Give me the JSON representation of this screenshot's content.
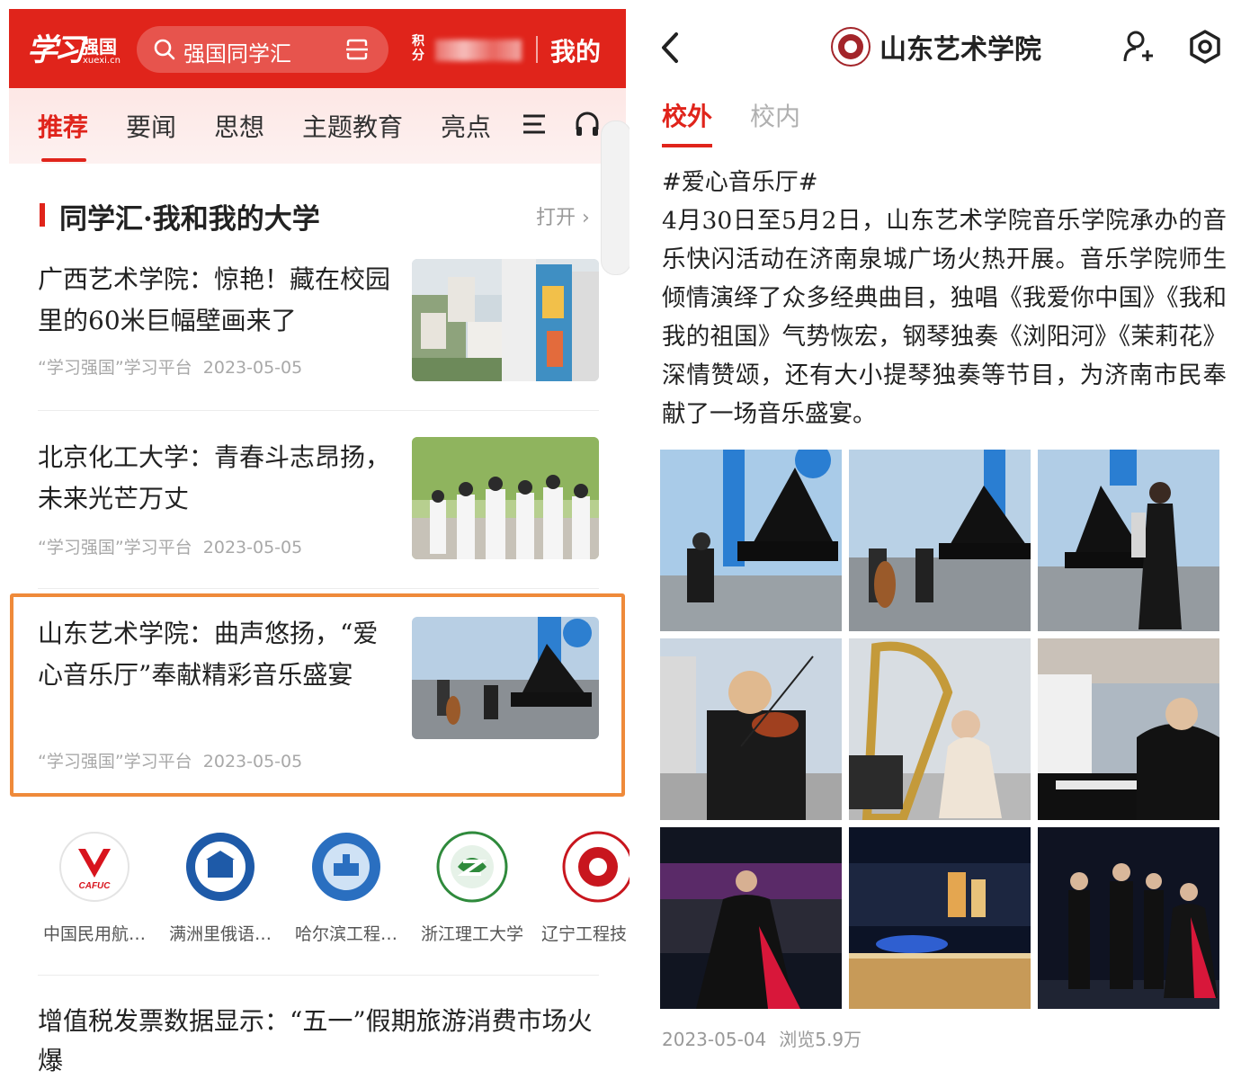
{
  "left": {
    "header": {
      "logo_calligraphy": "学习",
      "logo_name": "强国",
      "logo_url": "xuexi.cn",
      "search_placeholder": "强国同学汇",
      "points_label": "积分",
      "mine_label": "我的"
    },
    "tabs": [
      {
        "label": "推荐",
        "active": true
      },
      {
        "label": "要闻",
        "active": false
      },
      {
        "label": "思想",
        "active": false
      },
      {
        "label": "主题教育",
        "active": false
      },
      {
        "label": "亮点",
        "active": false
      }
    ],
    "section": {
      "title": "同学汇·我和我的大学",
      "open_label": "打开 ›"
    },
    "articles": [
      {
        "title": "广西艺术学院：惊艳！藏在校园里的60米巨幅壁画来了",
        "source": "“学习强国”学习平台",
        "date": "2023-05-05"
      },
      {
        "title": "北京化工大学：青春斗志昂扬，未来光芒万丈",
        "source": "“学习强国”学习平台",
        "date": "2023-05-05"
      },
      {
        "title": "山东艺术学院：曲声悠扬，“爱心音乐厅”奉献精彩音乐盛宴",
        "source": "“学习强国”学习平台",
        "date": "2023-05-05"
      }
    ],
    "universities": [
      {
        "name": "中国民用航…",
        "badge_text": "CAFUC"
      },
      {
        "name": "满洲里俄语…",
        "badge_text": ""
      },
      {
        "name": "哈尔滨工程…",
        "badge_text": ""
      },
      {
        "name": "浙江理工大学",
        "badge_text": ""
      },
      {
        "name": "辽宁工程技",
        "badge_text": ""
      }
    ],
    "bottom_article": {
      "title": "增值税发票数据显示：“五一”假期旅游消费市场火爆"
    }
  },
  "right": {
    "header": {
      "title": "山东艺术学院"
    },
    "tabs": [
      {
        "label": "校外",
        "active": true
      },
      {
        "label": "校内",
        "active": false
      }
    ],
    "post": {
      "tag": "#爱心音乐厅#",
      "body": "4月30日至5月2日，山东艺术学院音乐学院承办的音乐快闪活动在济南泉城广场火热开展。音乐学院师生倾情演绎了众多经典曲目，独唱《我爱你中国》《我和我的祖国》气势恢宏，钢琴独奏《浏阳河》《茉莉花》深情赞颂，还有大小提琴独奏等节目，为济南市民奉献了一场音乐盛宴。",
      "date": "2023-05-04",
      "views": "浏览5.9万"
    }
  },
  "colors": {
    "brand_red": "#e0241b",
    "highlight_orange": "#ef8a3a"
  }
}
